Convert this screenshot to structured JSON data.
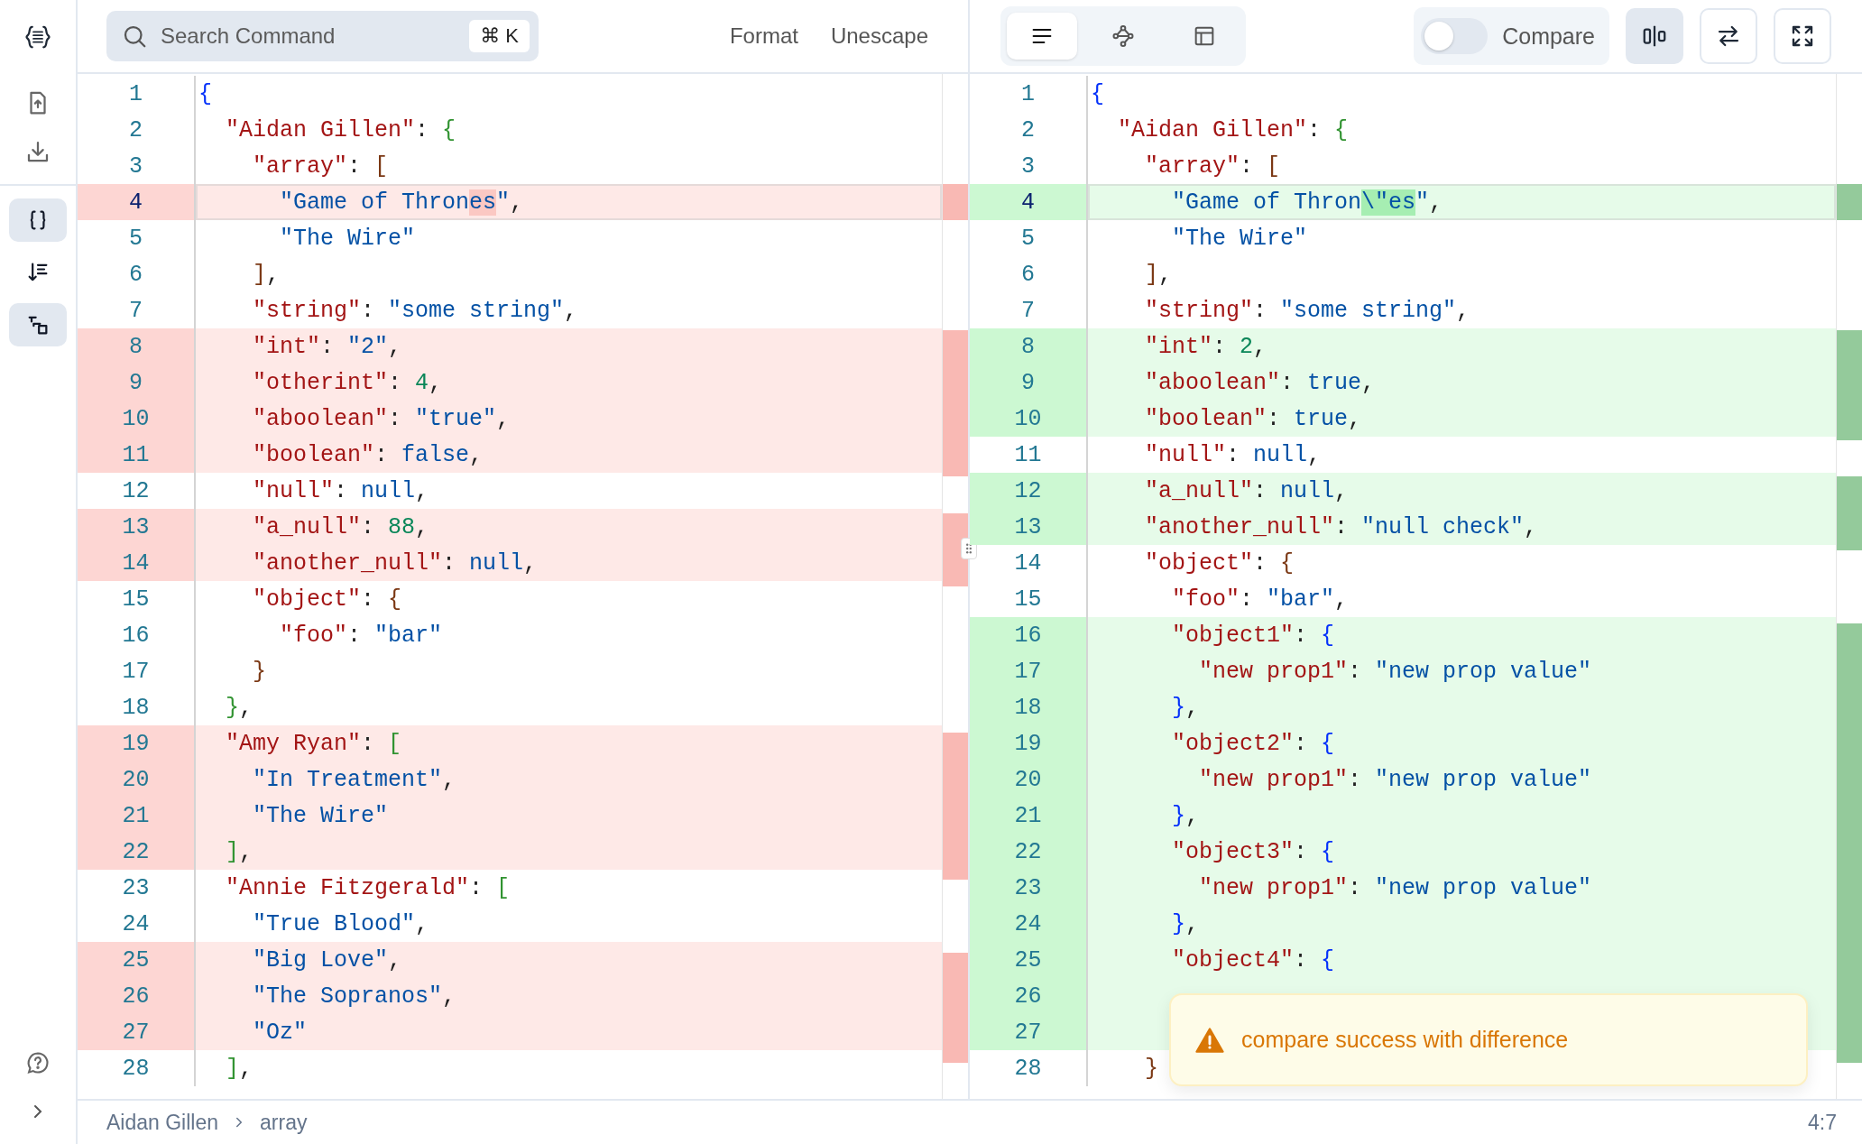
{
  "sidebar": {
    "tools": [
      {
        "kind": "format",
        "selected": true
      },
      {
        "kind": "sort",
        "selected": false
      },
      {
        "kind": "compare",
        "selected": true
      }
    ]
  },
  "toolbar": {
    "search": {
      "placeholder": "Search Command",
      "shortcut": "⌘ K"
    },
    "actions": [
      "Format",
      "Unescape"
    ],
    "view_modes": [
      {
        "kind": "text",
        "selected": true
      },
      {
        "kind": "graph",
        "selected": false
      },
      {
        "kind": "table",
        "selected": false
      }
    ],
    "compare": {
      "label": "Compare",
      "on": false
    },
    "split_view": {
      "on": true
    }
  },
  "left_editor": {
    "lines": [
      {
        "number": "1",
        "text": "{",
        "changed": false,
        "current": false
      },
      {
        "number": "2",
        "text": "  \"Aidan Gillen\": {",
        "changed": false,
        "current": false
      },
      {
        "number": "3",
        "text": "    \"array\": [",
        "changed": false,
        "current": false
      },
      {
        "number": "4",
        "segments": [
          {
            "text": "      \"Game of Thron",
            "changed": false
          },
          {
            "text": "es",
            "changed": true
          },
          {
            "text": "\",",
            "changed": false
          }
        ],
        "changed": true,
        "current": true
      },
      {
        "number": "5",
        "text": "      \"The Wire\"",
        "changed": false,
        "current": false
      },
      {
        "number": "6",
        "text": "    ],",
        "changed": false,
        "current": false
      },
      {
        "number": "7",
        "text": "    \"string\": \"some string\",",
        "changed": false,
        "current": false
      },
      {
        "number": "8",
        "text": "    \"int\": \"2\",",
        "changed": true,
        "current": false
      },
      {
        "number": "9",
        "text": "    \"otherint\": 4,",
        "changed": true,
        "current": false
      },
      {
        "number": "10",
        "text": "    \"aboolean\": \"true\",",
        "changed": true,
        "current": false
      },
      {
        "number": "11",
        "text": "    \"boolean\": false,",
        "changed": true,
        "current": false
      },
      {
        "number": "12",
        "text": "    \"null\": null,",
        "changed": false,
        "current": false
      },
      {
        "number": "13",
        "text": "    \"a_null\": 88,",
        "changed": true,
        "current": false
      },
      {
        "number": "14",
        "text": "    \"another_null\": null,",
        "changed": true,
        "current": false
      },
      {
        "number": "15",
        "text": "    \"object\": {",
        "changed": false,
        "current": false
      },
      {
        "number": "16",
        "text": "      \"foo\": \"bar\"",
        "changed": false,
        "current": false
      },
      {
        "number": "17",
        "text": "    }",
        "changed": false,
        "current": false
      },
      {
        "number": "18",
        "text": "  },",
        "changed": false,
        "current": false
      },
      {
        "number": "19",
        "text": "  \"Amy Ryan\": [",
        "changed": true,
        "current": false
      },
      {
        "number": "20",
        "text": "    \"In Treatment\",",
        "changed": true,
        "current": false
      },
      {
        "number": "21",
        "text": "    \"The Wire\"",
        "changed": true,
        "current": false
      },
      {
        "number": "22",
        "text": "  ],",
        "changed": true,
        "current": false
      },
      {
        "number": "23",
        "text": "  \"Annie Fitzgerald\": [",
        "changed": false,
        "current": false
      },
      {
        "number": "24",
        "text": "    \"True Blood\",",
        "changed": false,
        "current": false
      },
      {
        "number": "25",
        "text": "    \"Big Love\",",
        "changed": true,
        "current": false
      },
      {
        "number": "26",
        "text": "    \"The Sopranos\",",
        "changed": true,
        "current": false
      },
      {
        "number": "27",
        "text": "    \"Oz\"",
        "changed": true,
        "current": false
      },
      {
        "number": "28",
        "text": "  ],",
        "changed": false,
        "current": false
      }
    ]
  },
  "right_editor": {
    "lines": [
      {
        "number": "1",
        "text": "{",
        "changed": false,
        "current": false
      },
      {
        "number": "2",
        "text": "  \"Aidan Gillen\": {",
        "changed": false,
        "current": false
      },
      {
        "number": "3",
        "text": "    \"array\": [",
        "changed": false,
        "current": false
      },
      {
        "number": "4",
        "segments": [
          {
            "text": "      \"Game of Thron",
            "changed": false
          },
          {
            "text": "\\\"",
            "changed": true
          },
          {
            "text": "es",
            "changed": true
          },
          {
            "text": "\",",
            "changed": false
          }
        ],
        "changed": true,
        "current": true
      },
      {
        "number": "5",
        "text": "      \"The Wire\"",
        "changed": false,
        "current": false
      },
      {
        "number": "6",
        "text": "    ],",
        "changed": false,
        "current": false
      },
      {
        "number": "7",
        "text": "    \"string\": \"some string\",",
        "changed": false,
        "current": false
      },
      {
        "number": "8",
        "text": "    \"int\": 2,",
        "changed": true,
        "current": false
      },
      {
        "number": "9",
        "text": "    \"aboolean\": true,",
        "changed": true,
        "current": false
      },
      {
        "number": "10",
        "text": "    \"boolean\": true,",
        "changed": true,
        "current": false
      },
      {
        "number": "11",
        "text": "    \"null\": null,",
        "changed": false,
        "current": false
      },
      {
        "number": "12",
        "text": "    \"a_null\": null,",
        "changed": true,
        "current": false
      },
      {
        "number": "13",
        "text": "    \"another_null\": \"null check\",",
        "changed": true,
        "current": false
      },
      {
        "number": "14",
        "text": "    \"object\": {",
        "changed": false,
        "current": false
      },
      {
        "number": "15",
        "text": "      \"foo\": \"bar\",",
        "changed": false,
        "current": false
      },
      {
        "number": "16",
        "text": "      \"object1\": {",
        "changed": true,
        "current": false
      },
      {
        "number": "17",
        "text": "        \"new prop1\": \"new prop value\"",
        "changed": true,
        "current": false
      },
      {
        "number": "18",
        "text": "      },",
        "changed": true,
        "current": false
      },
      {
        "number": "19",
        "text": "      \"object2\": {",
        "changed": true,
        "current": false
      },
      {
        "number": "20",
        "text": "        \"new prop1\": \"new prop value\"",
        "changed": true,
        "current": false
      },
      {
        "number": "21",
        "text": "      },",
        "changed": true,
        "current": false
      },
      {
        "number": "22",
        "text": "      \"object3\": {",
        "changed": true,
        "current": false
      },
      {
        "number": "23",
        "text": "        \"new prop1\": \"new prop value\"",
        "changed": true,
        "current": false
      },
      {
        "number": "24",
        "text": "      },",
        "changed": true,
        "current": false
      },
      {
        "number": "25",
        "text": "      \"object4\": {",
        "changed": true,
        "current": false
      },
      {
        "number": "26",
        "changed": true,
        "current": false
      },
      {
        "number": "27",
        "changed": true,
        "current": false
      },
      {
        "number": "28",
        "text": "    }",
        "changed": false,
        "current": false
      }
    ]
  },
  "toast": {
    "kind": "warning",
    "message": "compare success with difference"
  },
  "status_bar": {
    "breadcrumb": [
      "Aidan Gillen",
      "array"
    ],
    "position": "4:7"
  }
}
